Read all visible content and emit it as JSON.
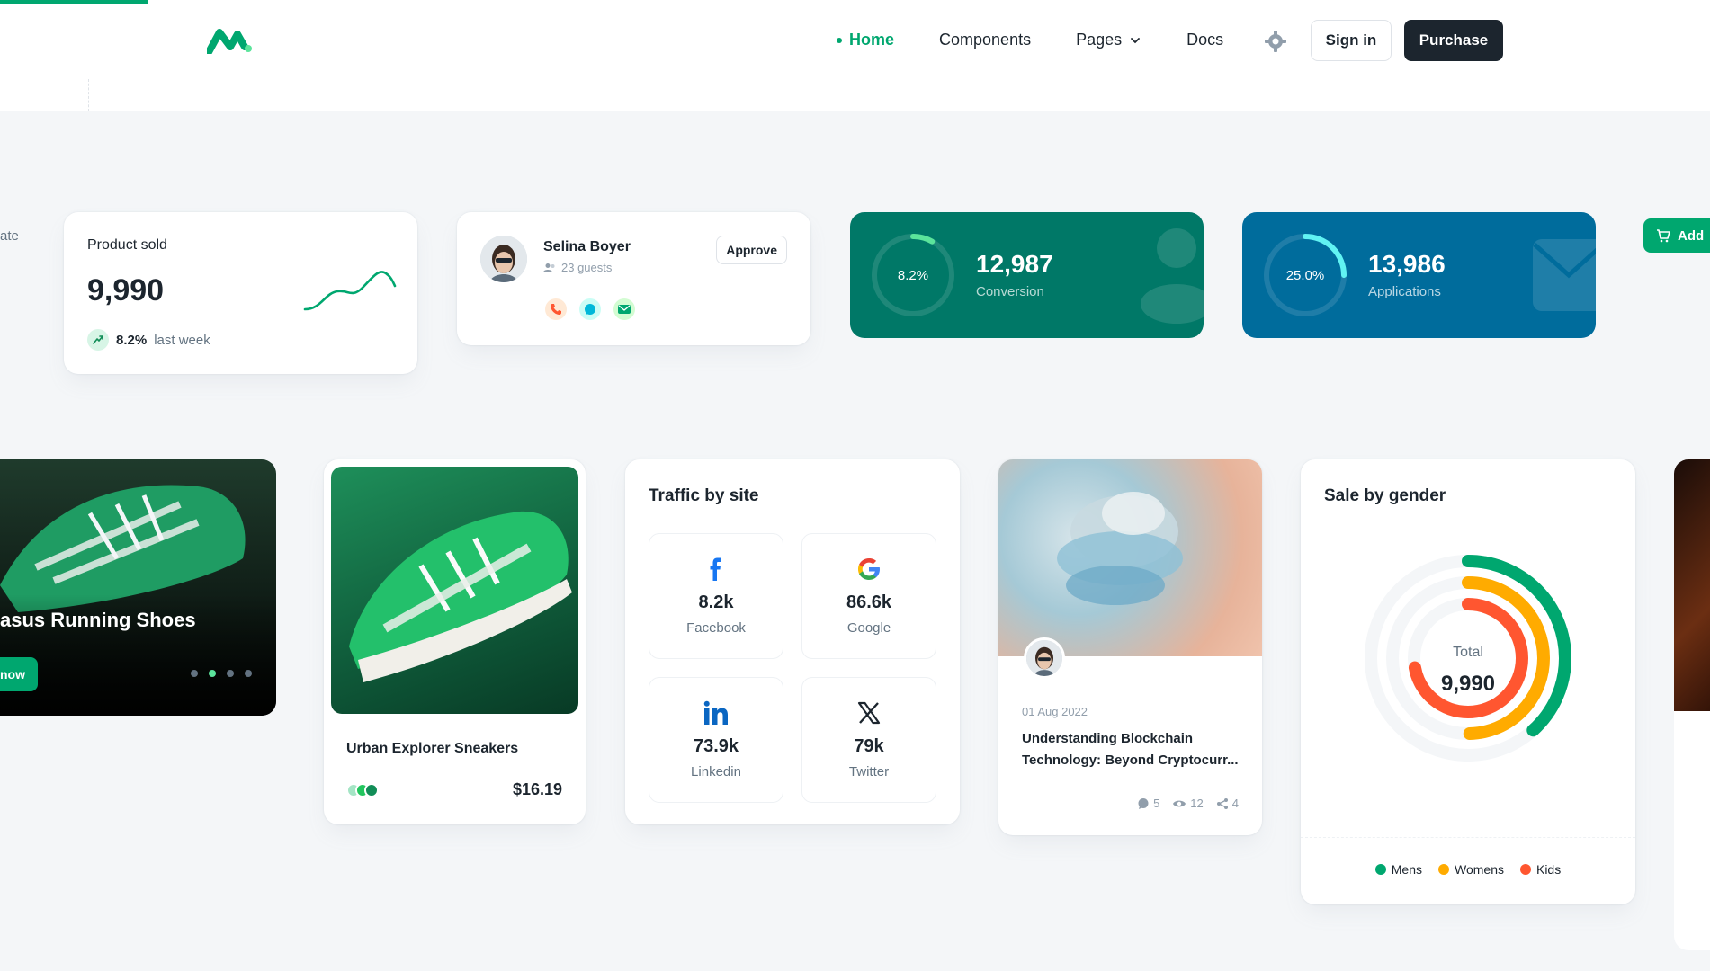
{
  "nav": {
    "items": [
      {
        "label": "Home",
        "active": true
      },
      {
        "label": "Components"
      },
      {
        "label": "Pages",
        "has_dropdown": true
      },
      {
        "label": "Docs"
      }
    ],
    "signin_label": "Sign in",
    "purchase_label": "Purchase"
  },
  "left_cut_text": "ate",
  "product_sold": {
    "label": "Product sold",
    "value": "9,990",
    "change": "8.2%",
    "period": "last week"
  },
  "contact": {
    "name": "Selina Boyer",
    "guests": "23 guests",
    "approve_label": "Approve"
  },
  "widgets": [
    {
      "percent": "8.2%",
      "value": "12,987",
      "label": "Conversion",
      "color": "#007867"
    },
    {
      "percent": "25.0%",
      "value": "13,986",
      "label": "Applications",
      "color": "#006c9c"
    }
  ],
  "add_button_label": "Add",
  "promo": {
    "title": "asus Running Shoes",
    "button_label": "now"
  },
  "product": {
    "name": "Urban Explorer Sneakers",
    "price": "$16.19",
    "colors": [
      "#a4e5c5",
      "#22c55e",
      "#118d57"
    ]
  },
  "traffic": {
    "title": "Traffic by site",
    "sites": [
      {
        "value": "8.2k",
        "label": "Facebook",
        "icon": "facebook-icon"
      },
      {
        "value": "86.6k",
        "label": "Google",
        "icon": "google-icon"
      },
      {
        "value": "73.9k",
        "label": "Linkedin",
        "icon": "linkedin-icon"
      },
      {
        "value": "79k",
        "label": "Twitter",
        "icon": "x-icon"
      }
    ]
  },
  "blog": {
    "date": "01 Aug 2022",
    "title": "Understanding Blockchain Technology: Beyond Cryptocurr...",
    "comments": "5",
    "views": "12",
    "shares": "4"
  },
  "gender": {
    "title": "Sale by gender",
    "total_label": "Total",
    "total_value": "9,990",
    "legend": [
      {
        "label": "Mens",
        "color": "#00a76f"
      },
      {
        "label": "Womens",
        "color": "#ffab00"
      },
      {
        "label": "Kids",
        "color": "#ff5630"
      }
    ]
  }
}
